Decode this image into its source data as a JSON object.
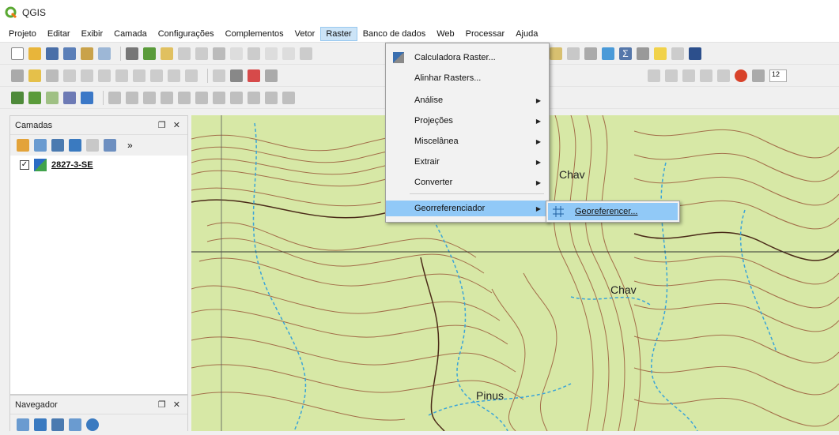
{
  "app": {
    "title": "QGIS"
  },
  "menubar": {
    "items": [
      {
        "label": "Projeto",
        "name": "menu-projeto"
      },
      {
        "label": "Editar",
        "name": "menu-editar"
      },
      {
        "label": "Exibir",
        "name": "menu-exibir"
      },
      {
        "label": "Camada",
        "name": "menu-camada"
      },
      {
        "label": "Configurações",
        "name": "menu-configuracoes"
      },
      {
        "label": "Complementos",
        "name": "menu-complementos"
      },
      {
        "label": "Vetor",
        "name": "menu-vetor"
      },
      {
        "label": "Raster",
        "name": "menu-raster"
      },
      {
        "label": "Banco de dados",
        "name": "menu-banco-de-dados"
      },
      {
        "label": "Web",
        "name": "menu-web"
      },
      {
        "label": "Processar",
        "name": "menu-processar"
      },
      {
        "label": "Ajuda",
        "name": "menu-ajuda"
      }
    ]
  },
  "raster_menu": {
    "items": [
      {
        "label": "Calculadora Raster...",
        "has_submenu": false
      },
      {
        "label": "Alinhar Rasters...",
        "has_submenu": false
      },
      {
        "label": "Análise",
        "has_submenu": true
      },
      {
        "label": "Projeções",
        "has_submenu": true
      },
      {
        "label": "Miscelânea",
        "has_submenu": true
      },
      {
        "label": "Extrair",
        "has_submenu": true
      },
      {
        "label": "Converter",
        "has_submenu": true
      },
      {
        "label": "Georreferenciador",
        "has_submenu": true,
        "highlighted": true
      }
    ],
    "submenu": {
      "label": "Georeferencer..."
    }
  },
  "layers_panel": {
    "title": "Camadas",
    "layers": [
      {
        "name": "2827-3-SE",
        "checked": true
      }
    ]
  },
  "navigator_panel": {
    "title": "Navegador"
  },
  "map_labels": [
    "Chav",
    "Chav",
    "Pinus"
  ],
  "toolbar": {
    "scale_field": "12"
  },
  "colors": {
    "map_green": "#d7e8a6",
    "contour": "#9a5a3a",
    "river": "#3aa4d8",
    "menu_highlight": "#91c9f7"
  }
}
